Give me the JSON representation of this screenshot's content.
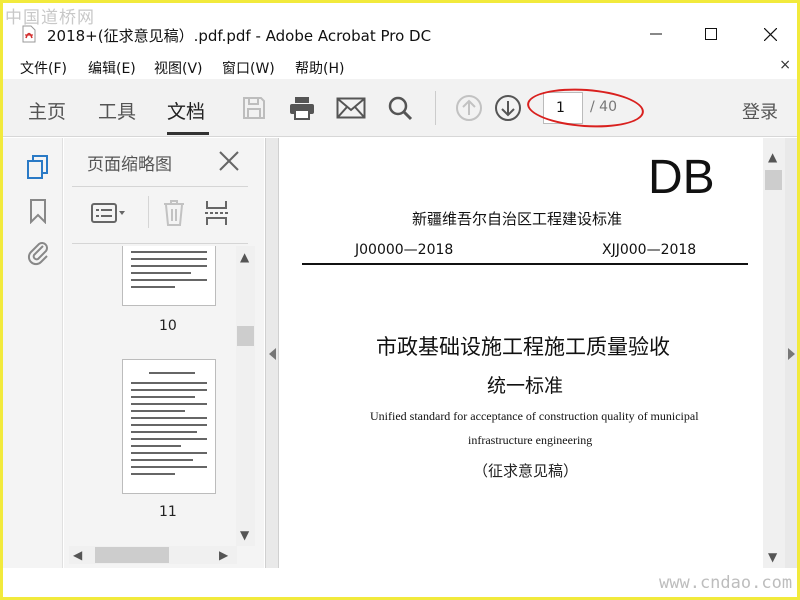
{
  "watermarks": {
    "top": "中国道桥网",
    "bottom": "www.cndao.com"
  },
  "window": {
    "title": "2018+(征求意见稿）.pdf.pdf - Adobe Acrobat Pro DC"
  },
  "menu": {
    "items": [
      "文件(F)",
      "编辑(E)",
      "视图(V)",
      "窗口(W)",
      "帮助(H)"
    ],
    "close": "×"
  },
  "toolbar": {
    "tabs": [
      "主页",
      "工具",
      "文档"
    ],
    "active_tab": "文档",
    "page_current": "1",
    "page_total": "/ 40",
    "login": "登录",
    "icons": [
      "save-icon",
      "print-icon",
      "email-icon",
      "search-icon",
      "page-up-icon",
      "page-down-icon"
    ]
  },
  "sidebar": {
    "icons": [
      "page-thumbnails-icon",
      "bookmark-icon",
      "attachment-icon"
    ]
  },
  "thumbnail_panel": {
    "title": "页面缩略图",
    "thumbs": [
      {
        "label": "10"
      },
      {
        "label": "11"
      }
    ]
  },
  "document": {
    "logo": "DB",
    "standard_name": "新疆维吾尔自治区工程建设标准",
    "code_left": "J00000—2018",
    "code_right": "XJJ000—2018",
    "title_line1": "市政基础设施工程施工质量验收",
    "title_line2": "统一标准",
    "english_line1": "Unified standard for acceptance of construction quality of municipal",
    "english_line2": "infrastructure engineering",
    "draft_note": "（征求意见稿）"
  },
  "colors": {
    "highlight_ellipse": "#d9201e",
    "frame_border": "#f2ea3c"
  }
}
